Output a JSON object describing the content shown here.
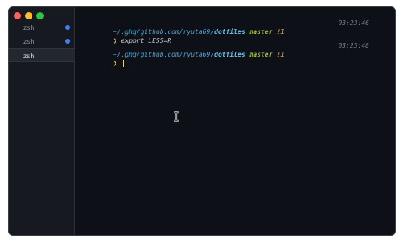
{
  "window": {
    "traffic_lights": [
      "close",
      "minimize",
      "maximize"
    ],
    "colors": {
      "close": "#ff5f57",
      "minimize": "#febc2e",
      "maximize": "#28c840"
    }
  },
  "sidebar": {
    "tabs": [
      {
        "label": "zsh",
        "active": false,
        "has_activity": true
      },
      {
        "label": "zsh",
        "active": false,
        "has_activity": true
      },
      {
        "label": "zsh",
        "active": true,
        "has_activity": false
      }
    ]
  },
  "terminal": {
    "blocks": [
      {
        "path_prefix": "~/.ghq/github.com/ryuta69/",
        "path_dir": "dotfiles",
        "branch": "master",
        "status": "!1",
        "time": "03:23:46",
        "prompt": "❯",
        "command": "export LESS=R"
      },
      {
        "path_prefix": "~/.ghq/github.com/ryuta69/",
        "path_dir": "dotfiles",
        "branch": "master",
        "status": "!1",
        "time": "03:23:48",
        "prompt": "❯",
        "command": ""
      }
    ]
  }
}
